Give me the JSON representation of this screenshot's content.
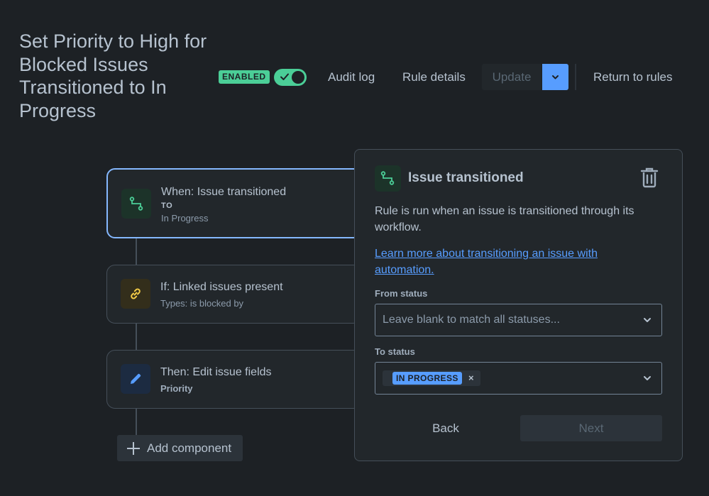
{
  "header": {
    "title": "Set Priority to High for Blocked Issues Transitioned to In Progress",
    "status_badge": "ENABLED",
    "toggle_enabled": true,
    "audit_log": "Audit log",
    "rule_details": "Rule details",
    "update": "Update",
    "return_to_rules": "Return to rules"
  },
  "chain": {
    "trigger": {
      "title": "When: Issue transitioned",
      "label": "TO",
      "detail": "In Progress",
      "icon": "transition-icon"
    },
    "condition": {
      "title": "If: Linked issues present",
      "detail": "Types: is blocked by",
      "icon": "link-icon"
    },
    "action": {
      "title": "Then: Edit issue fields",
      "detail": "Priority",
      "icon": "pencil-icon"
    },
    "add_component": "Add component"
  },
  "panel": {
    "title": "Issue transitioned",
    "description": "Rule is run when an issue is transitioned through its workflow.",
    "learn_more": "Learn more about transitioning an issue with automation.",
    "from_status": {
      "label": "From status",
      "placeholder": "Leave blank to match all statuses..."
    },
    "to_status": {
      "label": "To status",
      "selected": [
        "IN PROGRESS"
      ]
    },
    "back": "Back",
    "next": "Next"
  },
  "colors": {
    "background": "#1d2125",
    "enabled_green": "#4bce97",
    "accent_blue": "#579dff",
    "selected_border": "#85b8ff"
  }
}
